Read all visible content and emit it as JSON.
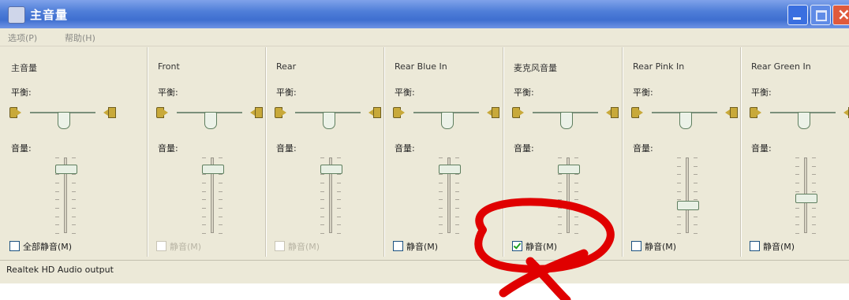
{
  "window": {
    "title": "主音量"
  },
  "menu": {
    "items": [
      "选项(P)",
      "帮助(H)"
    ]
  },
  "labels": {
    "balance": "平衡:",
    "volume": "音量:"
  },
  "channels": [
    {
      "name": "主音量",
      "mute_label": "全部静音(M)",
      "muted": false,
      "enabled": true,
      "volume": 0.88,
      "balance": 0.5
    },
    {
      "name": "Front",
      "mute_label": "静音(M)",
      "muted": false,
      "enabled": false,
      "volume": 0.88,
      "balance": 0.5
    },
    {
      "name": "Rear",
      "mute_label": "静音(M)",
      "muted": false,
      "enabled": false,
      "volume": 0.88,
      "balance": 0.5
    },
    {
      "name": "Rear Blue In",
      "mute_label": "静音(M)",
      "muted": false,
      "enabled": true,
      "volume": 0.88,
      "balance": 0.5
    },
    {
      "name": "麦克风音量",
      "mute_label": "静音(M)",
      "muted": true,
      "enabled": true,
      "volume": 0.88,
      "balance": 0.5
    },
    {
      "name": "Rear Pink In",
      "mute_label": "静音(M)",
      "muted": false,
      "enabled": true,
      "volume": 0.35,
      "balance": 0.5
    },
    {
      "name": "Rear Green In",
      "mute_label": "静音(M)",
      "muted": false,
      "enabled": true,
      "volume": 0.45,
      "balance": 0.5
    }
  ],
  "statusbar": {
    "text": "Realtek HD Audio output"
  },
  "annotation": {
    "color": "#e00000"
  }
}
